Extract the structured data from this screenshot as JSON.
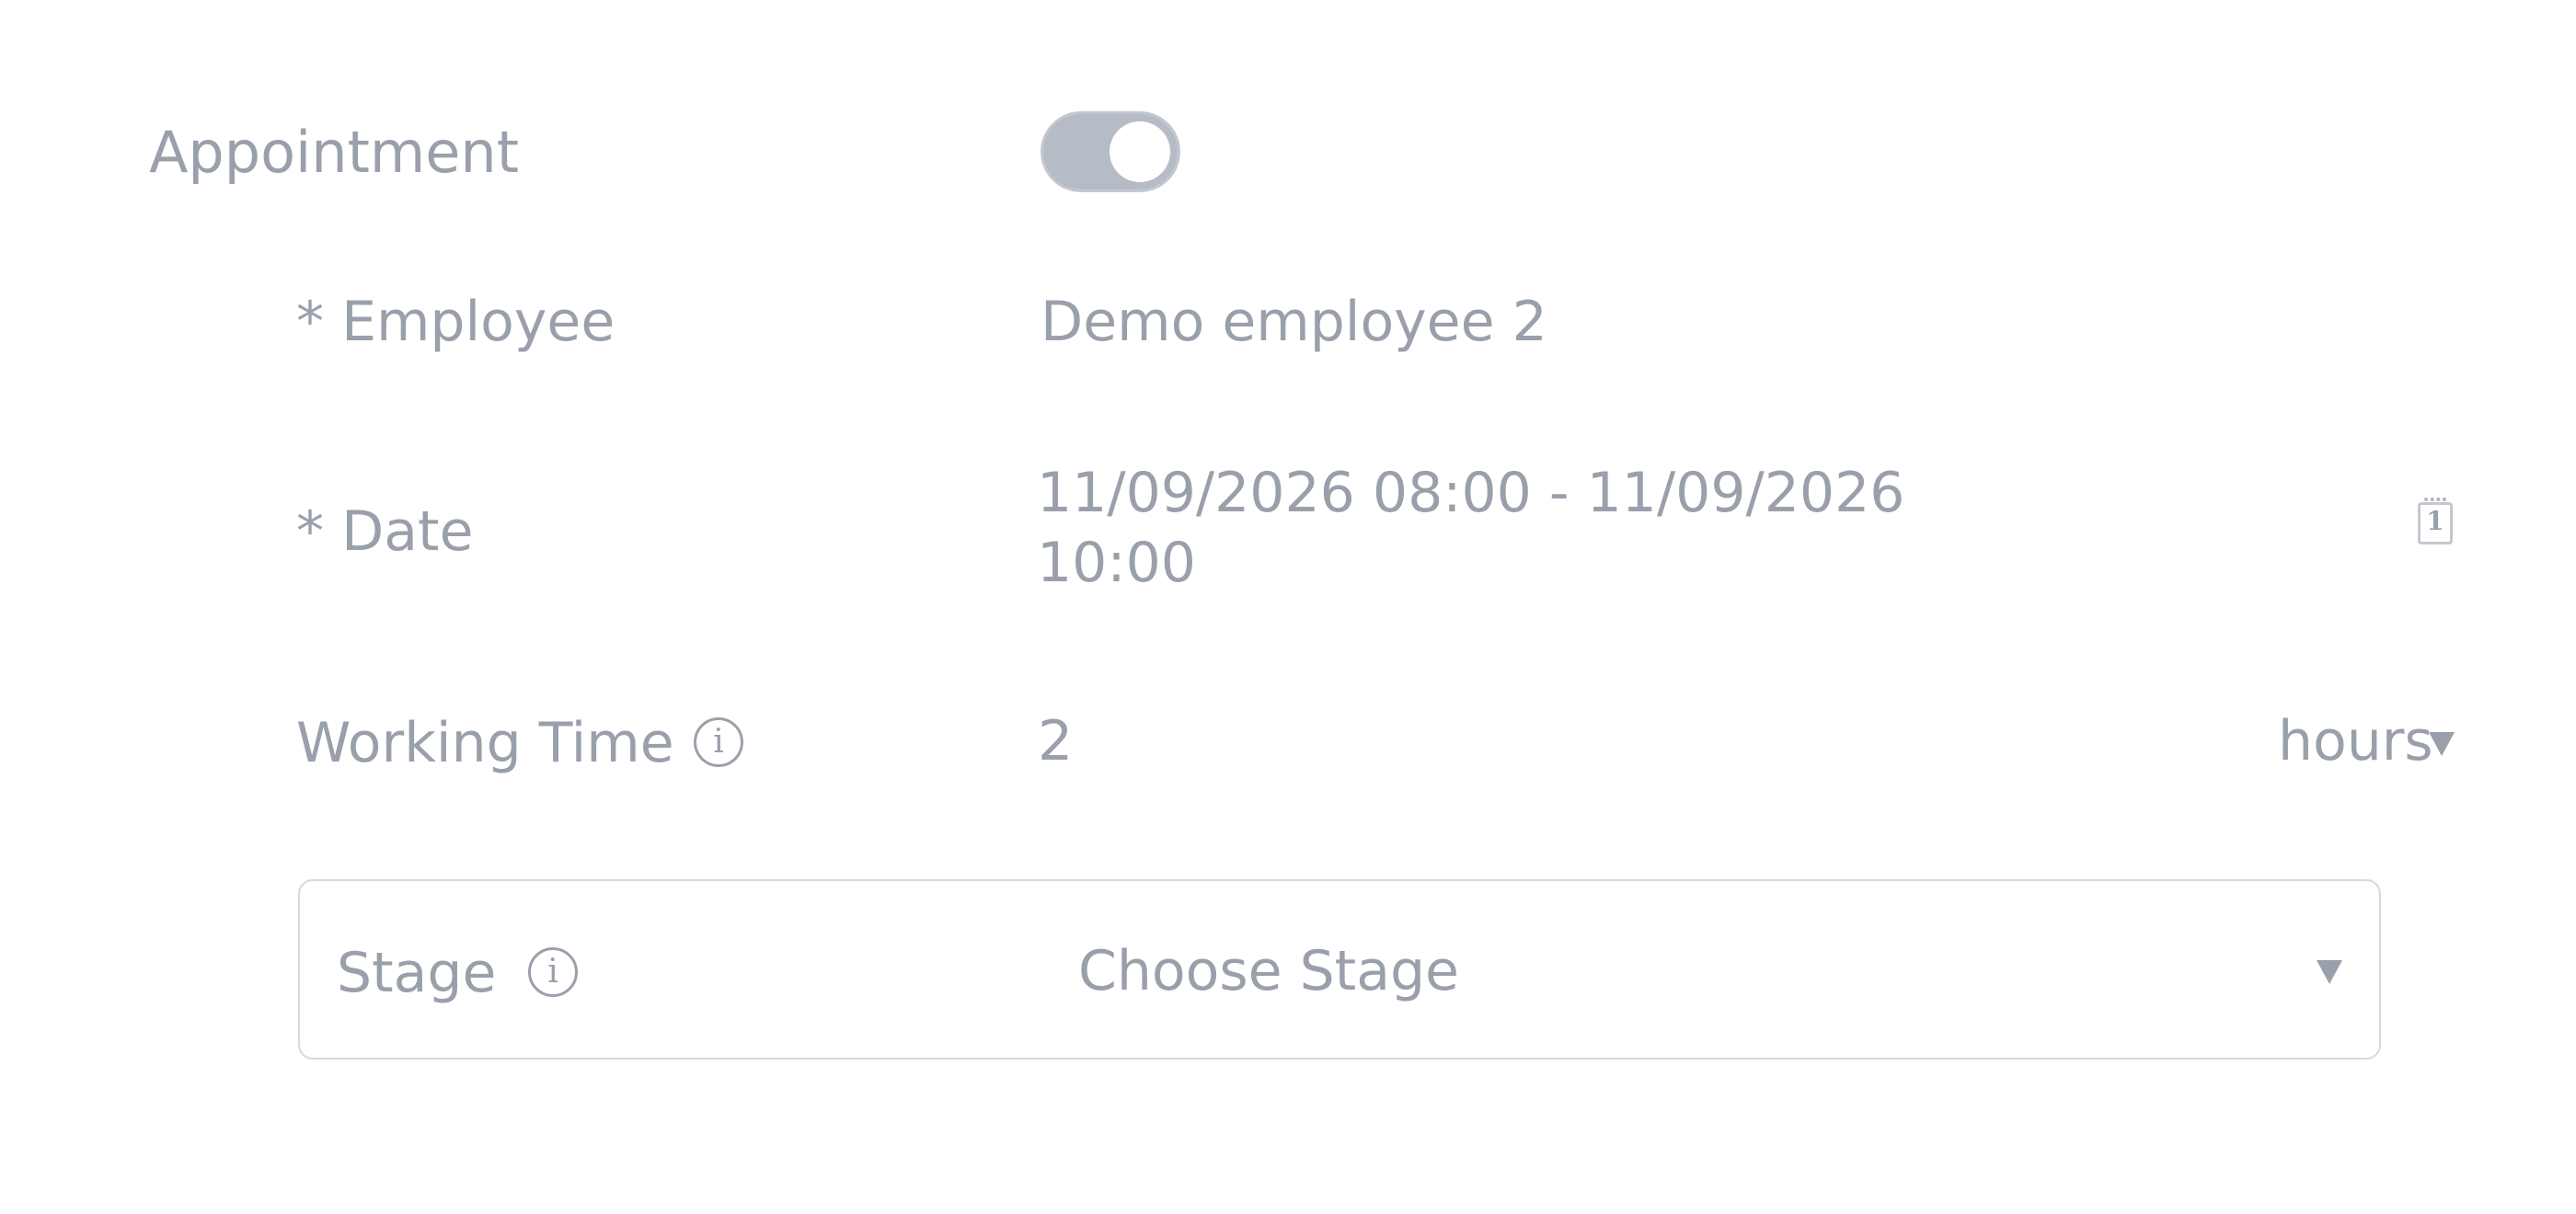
{
  "appointment": {
    "label": "Appointment",
    "toggle_on": true
  },
  "employee": {
    "label": "* Employee",
    "value": "Demo employee 2"
  },
  "date": {
    "label": "* Date",
    "value_line1": "11/09/2026 08:00 - 11/09/2026",
    "value_line2": "10:00",
    "calendar_icon_number": "1",
    "icon": "calendar-icon"
  },
  "working_time": {
    "label": "Working Time",
    "info_glyph": "i",
    "value": "2",
    "unit": "hours"
  },
  "stage": {
    "label": "Stage",
    "info_glyph": "i",
    "placeholder": "Choose Stage"
  },
  "colors": {
    "text": "#9aa0ab",
    "toggle_track": "#b6bcc6",
    "border": "#d6d9de"
  }
}
